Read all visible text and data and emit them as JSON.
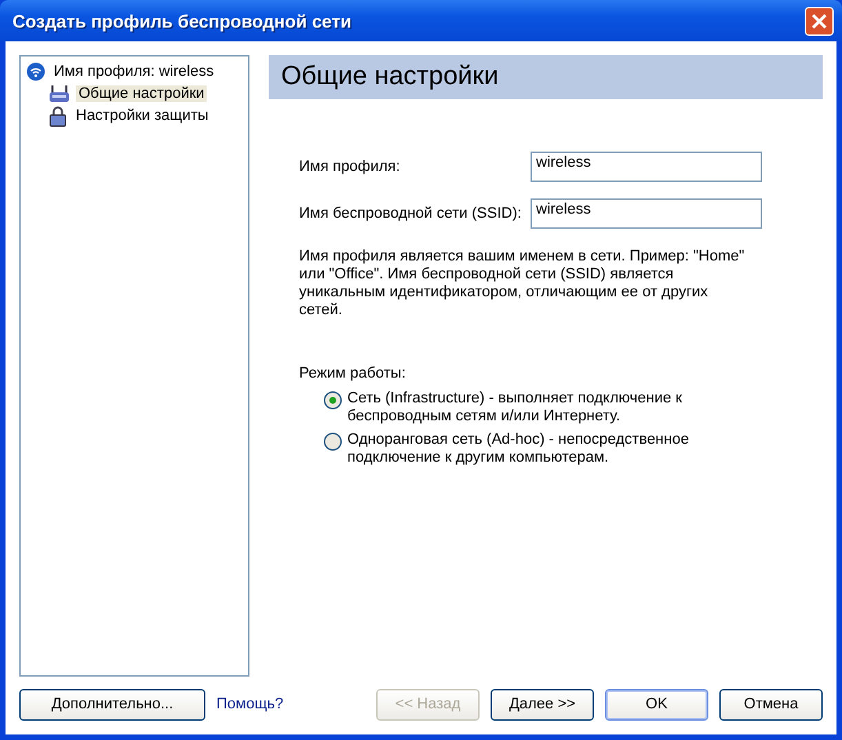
{
  "window": {
    "title": "Создать профиль беспроводной сети"
  },
  "tree": {
    "label": "Имя профиля: wireless",
    "children": [
      {
        "label": "Общие настройки",
        "kind": "router",
        "selected": true
      },
      {
        "label": "Настройки защиты",
        "kind": "lock",
        "selected": false
      }
    ]
  },
  "page": {
    "title": "Общие настройки",
    "fields": [
      {
        "label": "Имя профиля:",
        "value": "wireless"
      },
      {
        "label": "Имя беспроводной сети (SSID):",
        "value": "wireless"
      }
    ],
    "description": "Имя профиля является вашим именем в сети. Пример: \"Home\" или \"Office\". Имя беспроводной сети (SSID) является уникальным идентификатором, отличающим ее от других сетей.",
    "mode_label": "Режим работы:",
    "modes": [
      {
        "label": "Сеть (Infrastructure) - выполняет подключение к беспроводным сетям и/или Интернету.",
        "selected": true
      },
      {
        "label": "Одноранговая сеть (Ad-hoc) - непосредственное подключение к другим компьютерам.",
        "selected": false
      }
    ]
  },
  "footer": {
    "advanced": "Дополнительно...",
    "help": "Помощь?",
    "buttons": [
      {
        "label": "<< Назад",
        "disabled": true,
        "default": false
      },
      {
        "label": "Далее >>",
        "disabled": false,
        "default": false
      },
      {
        "label": "OK",
        "disabled": false,
        "default": true
      },
      {
        "label": "Отмена",
        "disabled": false,
        "default": false
      }
    ]
  }
}
